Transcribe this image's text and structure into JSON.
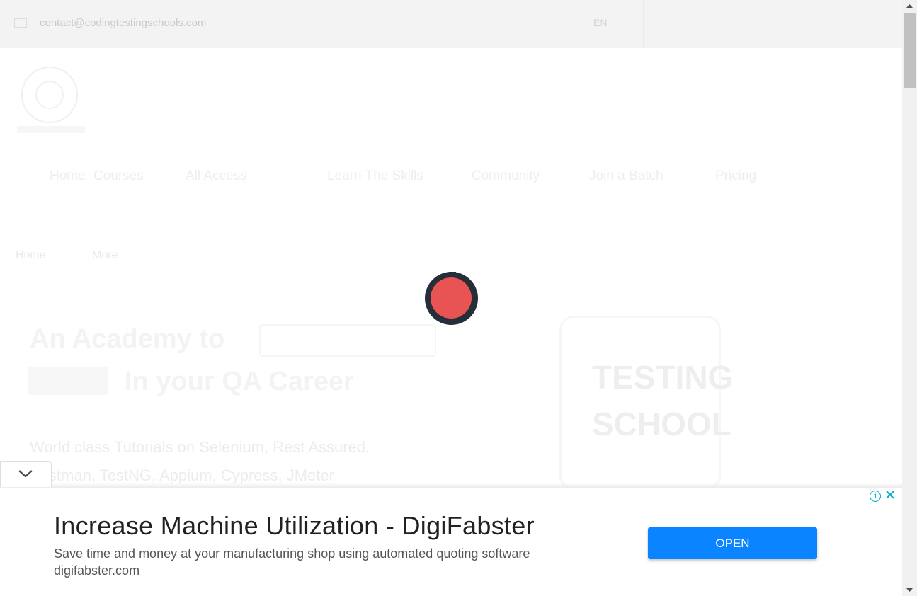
{
  "topbar": {
    "email": "contact@codingtestingschools.com",
    "language": "EN"
  },
  "nav": {
    "items": [
      "Home",
      "Courses",
      "All Access",
      "Learn The Skills",
      "Community",
      "Join a Batch",
      "Pricing"
    ]
  },
  "breadcrumb": {
    "first": "Home",
    "second": "More"
  },
  "hero": {
    "line1_prefix": "An Academy to",
    "line2": "In your QA Career",
    "subtitle": "World class Tutorials on Selenium, Rest Assured, Postman, TestNG, Appium, Cypress, JMeter"
  },
  "illustration": {
    "line1": "TESTING",
    "line2": "SCHOOL"
  },
  "ad": {
    "headline": "Increase Machine Utilization - DigiFabster",
    "description": "Save time and money at your manufacturing shop using automated quoting software",
    "url": "digifabster.com",
    "cta_label": "OPEN",
    "info_glyph": "i"
  },
  "loader": {
    "ring_color": "#262e3a",
    "dot_color": "#e85353"
  },
  "colors": {
    "ad_button": "#0a84ff",
    "ad_info": "#00aecd"
  }
}
